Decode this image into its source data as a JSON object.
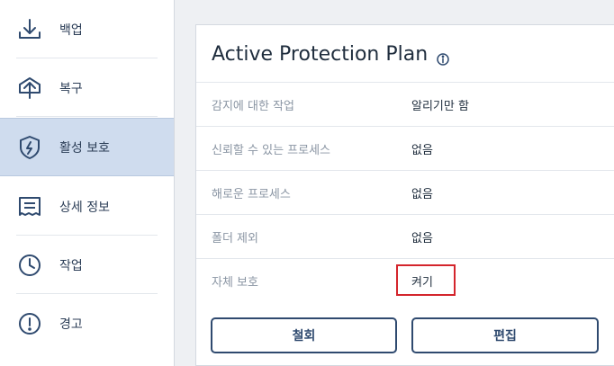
{
  "sidebar": {
    "items": [
      {
        "label": "백업",
        "icon": "backup-icon"
      },
      {
        "label": "복구",
        "icon": "recovery-icon"
      },
      {
        "label": "활성 보호",
        "icon": "shield-icon",
        "active": true
      },
      {
        "label": "상세 정보",
        "icon": "details-icon"
      },
      {
        "label": "작업",
        "icon": "clock-icon"
      },
      {
        "label": "경고",
        "icon": "alert-icon"
      }
    ]
  },
  "panel": {
    "title": "Active Protection Plan",
    "rows": [
      {
        "label": "감지에 대한 작업",
        "value": "알리기만 함"
      },
      {
        "label": "신뢰할 수 있는 프로세스",
        "value": "없음"
      },
      {
        "label": "해로운 프로세스",
        "value": "없음"
      },
      {
        "label": "폴더 제외",
        "value": "없음"
      },
      {
        "label": "자체 보호",
        "value": "켜기"
      }
    ],
    "revoke_label": "철회",
    "edit_label": "편집"
  },
  "colors": {
    "accent": "#2f4a6f",
    "active_bg": "#cfdcee",
    "highlight": "#d4252c"
  }
}
